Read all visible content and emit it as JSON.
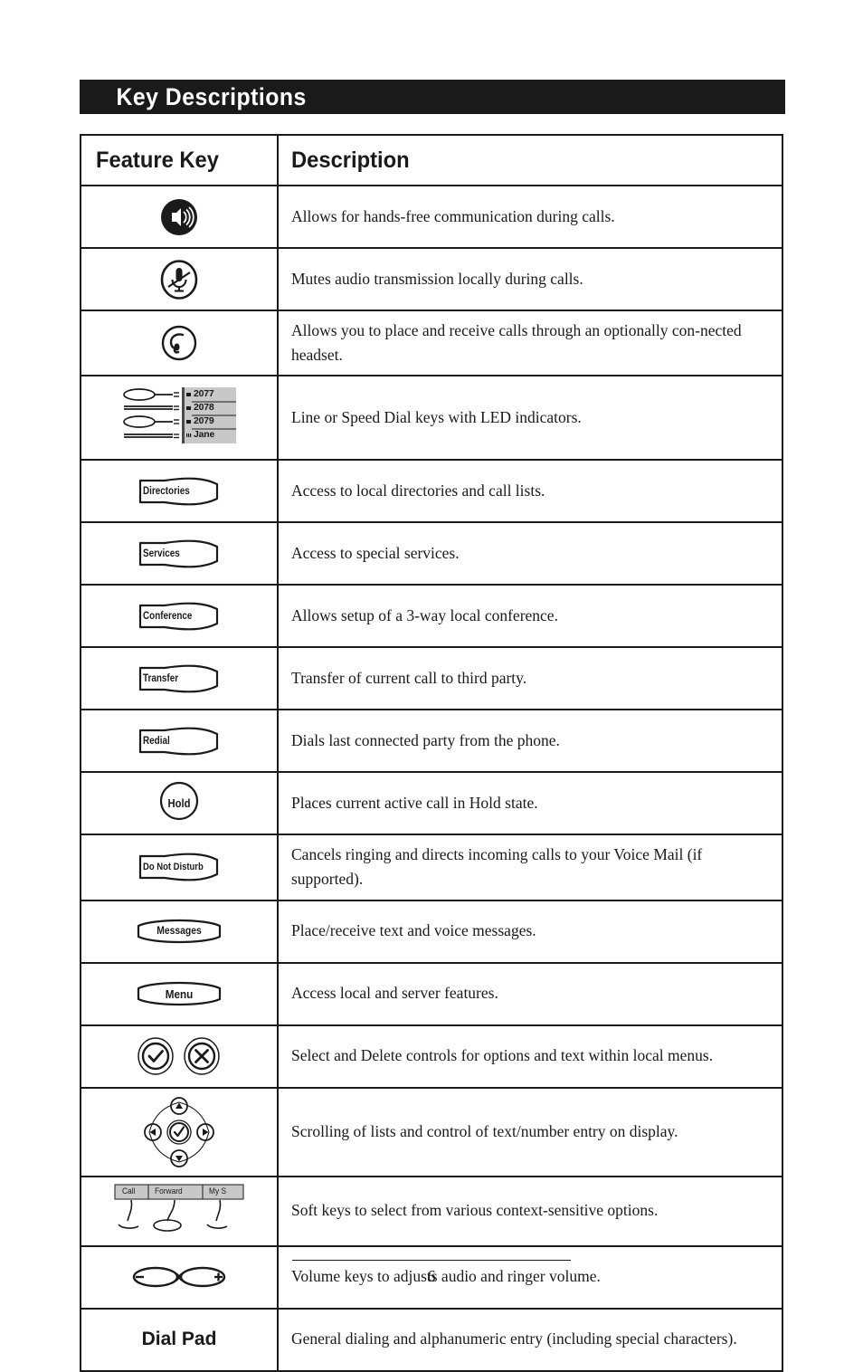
{
  "page": {
    "banner_title": "Key Descriptions",
    "page_number": "6"
  },
  "table": {
    "headers": {
      "feature_key": "Feature Key",
      "description": "Description"
    },
    "rows": [
      {
        "key_type": "speaker-icon",
        "key_label": "",
        "description": "Allows for hands-free communication during calls."
      },
      {
        "key_type": "mute-icon",
        "key_label": "",
        "description": "Mutes audio transmission locally during calls."
      },
      {
        "key_type": "headset-icon",
        "key_label": "",
        "description": "Allows you to place and receive calls through an optionally con-nected headset."
      },
      {
        "key_type": "line-keys",
        "key_label": "",
        "description": "Line or Speed Dial keys with LED indicators."
      },
      {
        "key_type": "phone-key",
        "key_label": "Directories",
        "description": "Access to local directories and call lists."
      },
      {
        "key_type": "phone-key",
        "key_label": "Services",
        "description": "Access to special services."
      },
      {
        "key_type": "phone-key",
        "key_label": "Conference",
        "description": "Allows setup of a 3-way local conference."
      },
      {
        "key_type": "phone-key",
        "key_label": "Transfer",
        "description": "Transfer of current call to third party."
      },
      {
        "key_type": "phone-key",
        "key_label": "Redial",
        "description": "Dials last connected party from the phone."
      },
      {
        "key_type": "hold-key",
        "key_label": "Hold",
        "description": "Places current active call in Hold state."
      },
      {
        "key_type": "phone-key",
        "key_label": "Do Not Disturb",
        "description": "Cancels ringing and directs incoming calls to your Voice Mail (if supported)."
      },
      {
        "key_type": "phone-key-center",
        "key_label": "Messages",
        "description": "Place/receive text and voice messages."
      },
      {
        "key_type": "phone-key-center",
        "key_label": "Menu",
        "description": "Access local and server features."
      },
      {
        "key_type": "select-delete-icons",
        "key_label": "",
        "description": "Select and Delete controls for options and text within local menus."
      },
      {
        "key_type": "navigation-pad-icon",
        "key_label": "",
        "description": "Scrolling of lists and control of text/number entry on display."
      },
      {
        "key_type": "soft-keys",
        "key_label": "",
        "description": "Soft keys to select from various context-sensitive options."
      },
      {
        "key_type": "volume-keys-icon",
        "key_label": "",
        "description": "Volume keys to adjusts audio and ringer volume."
      },
      {
        "key_type": "dial-pad-text",
        "key_label": "Dial Pad",
        "description": "General dialing and alphanumeric entry (including special characters)."
      }
    ]
  },
  "line_keys": {
    "labels": [
      "2077",
      "2078",
      "2079",
      "Jane"
    ]
  },
  "soft_keys": {
    "labels": [
      "Call",
      "Forward",
      "My S"
    ]
  },
  "volume_keys": {
    "minus": "−",
    "plus": "+"
  },
  "colors": {
    "ink": "#1a1a1a",
    "paper": "#ffffff",
    "lcd_gray": "#c8c8c8"
  }
}
